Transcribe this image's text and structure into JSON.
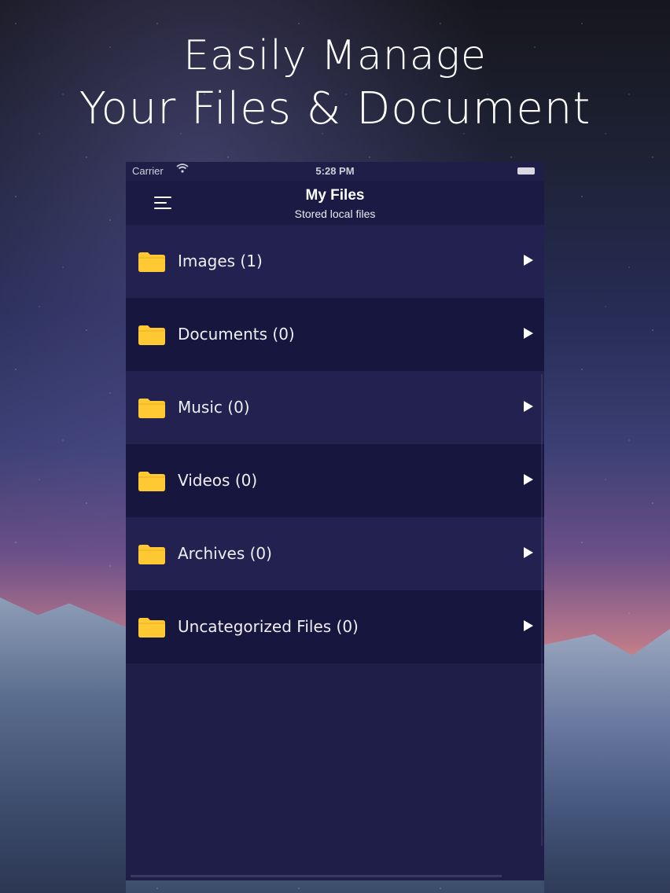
{
  "headline": {
    "line1": "Easily Manage",
    "line2": "Your Files & Document"
  },
  "status_bar": {
    "carrier": "Carrier",
    "time": "5:28 PM",
    "wifi_icon": "wifi-icon",
    "battery_icon": "battery-icon"
  },
  "navbar": {
    "menu_icon": "menu-icon",
    "title": "My Files",
    "subtitle": "Stored local files"
  },
  "folders": [
    {
      "label": "Images (1)"
    },
    {
      "label": "Documents (0)"
    },
    {
      "label": "Music (0)"
    },
    {
      "label": "Videos (0)"
    },
    {
      "label": "Archives (0)"
    },
    {
      "label": "Uncategorized Files (0)"
    }
  ],
  "colors": {
    "folder_yellow": "#FFC933",
    "nav_background": "#1a1a44",
    "row_light": "#222150",
    "row_dark": "#17163f"
  }
}
